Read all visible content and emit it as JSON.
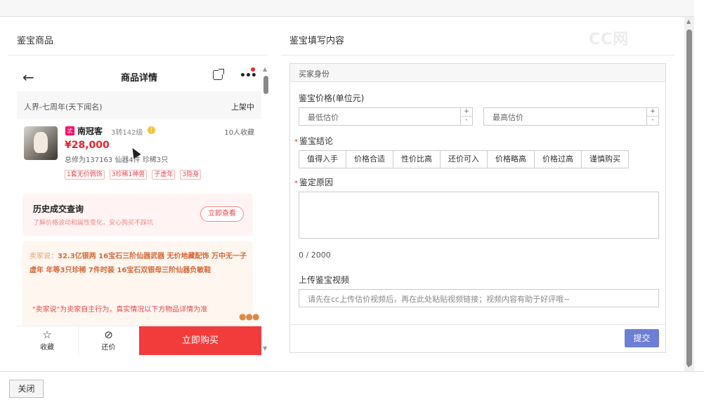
{
  "left_panel": {
    "title": "鉴宝商品"
  },
  "right_panel": {
    "title": "鉴宝填写内容"
  },
  "watermark": "CC网",
  "phone": {
    "nav_title": "商品详情",
    "nav_more": "•••",
    "server": "人界-七周年(天下闻名)",
    "status": "上架中",
    "item": {
      "badge": "武",
      "name": "南冠客",
      "level": "3转142级",
      "favorites": "10人收藏",
      "price": "¥28,000",
      "stats": "总修为137163  仙器4件  珍稀3只",
      "tags": [
        "1套无价佩饰",
        "3珍稀1神兽",
        "子虚年",
        "3隐身"
      ]
    },
    "history": {
      "title": "历史成交查询",
      "subtitle": "了解价格波动和属性变化，安心购买不踩坑",
      "button": "立即查看"
    },
    "seller": {
      "label": "卖家说：",
      "text": "32.3亿银两 16宝石三阶仙器武器 无价地藏配饰 万中无一子虚年 年等3只珍稀 7件时装 16宝石双银母三阶仙器负敏鞋",
      "note": "\"卖家说\"为卖家自主行为，真实情况以下方物品详情为准"
    },
    "bottom": {
      "favorite": "收藏",
      "bargain": "还价",
      "buy": "立即购买"
    }
  },
  "form": {
    "section": "买家身份",
    "price_label": "鉴宝价格(单位元)",
    "min_placeholder": "最低估价",
    "max_placeholder": "最高估价",
    "conclusion_label": "鉴宝结论",
    "conclusions": [
      "值得入手",
      "价格合适",
      "性价比高",
      "还价可入",
      "价格略高",
      "价格过高",
      "谨慎购买"
    ],
    "reason_label": "鉴定原因",
    "counter": "0 / 2000",
    "video_label": "上传鉴宝视频",
    "video_placeholder": "请先在cc上传估价视频后，再在此处粘贴视频链接；视频内容有助于好评哦~",
    "submit": "提交"
  },
  "footer": {
    "close": "关闭"
  }
}
